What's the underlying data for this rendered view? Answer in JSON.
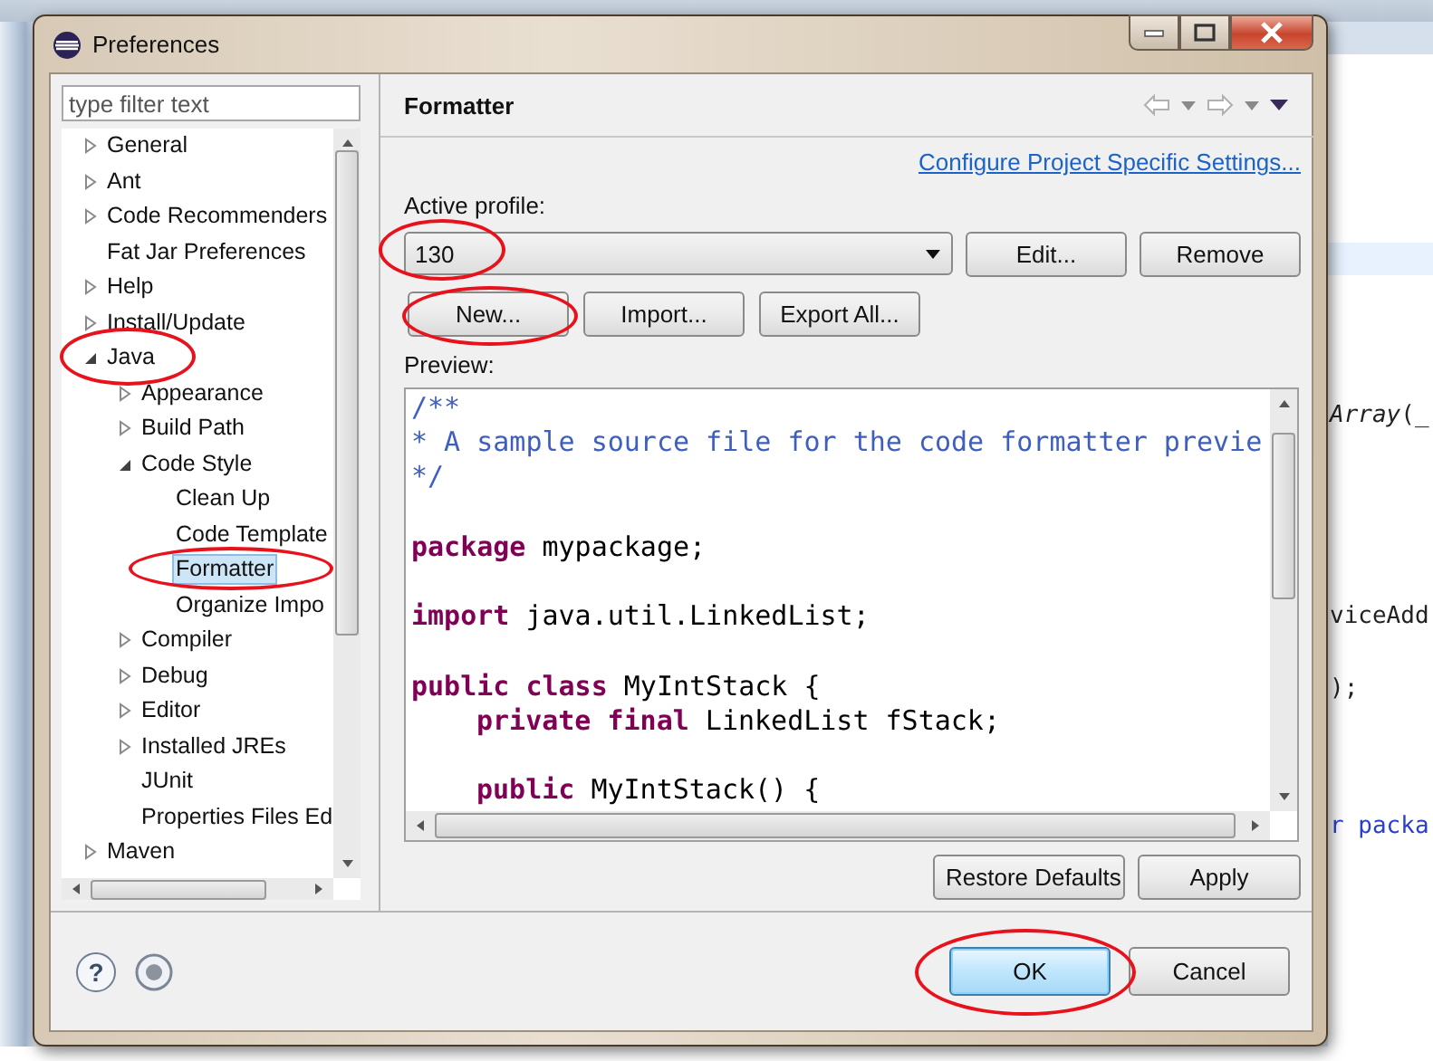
{
  "background_editor": {
    "fragments": [
      {
        "text": "*Array*(_",
        "kind": "code"
      },
      {
        "text": "viceAdd",
        "kind": "code"
      },
      {
        "text": ");",
        "kind": "code"
      },
      {
        "text": "r packa",
        "kind": "keyword"
      }
    ]
  },
  "window": {
    "title": "Preferences"
  },
  "filter": {
    "placeholder": "type filter text"
  },
  "tree": [
    {
      "label": "General",
      "kind": "folder",
      "expanded": false,
      "selected": false
    },
    {
      "label": "Ant",
      "kind": "folder",
      "expanded": false,
      "selected": false
    },
    {
      "label": "Code Recommenders",
      "kind": "folder",
      "expanded": false,
      "selected": false
    },
    {
      "label": "Fat Jar Preferences",
      "kind": "leaf",
      "selected": false
    },
    {
      "label": "Help",
      "kind": "folder",
      "expanded": false,
      "selected": false
    },
    {
      "label": "Install/Update",
      "kind": "folder",
      "expanded": false,
      "selected": false
    },
    {
      "label": "Java",
      "kind": "folder",
      "expanded": true,
      "selected": false,
      "circled": true,
      "children": [
        {
          "label": "Appearance",
          "kind": "folder",
          "expanded": false,
          "selected": false
        },
        {
          "label": "Build Path",
          "kind": "folder",
          "expanded": false,
          "selected": false
        },
        {
          "label": "Code Style",
          "kind": "folder",
          "expanded": true,
          "selected": false,
          "children": [
            {
              "label": "Clean Up",
              "kind": "leaf",
              "selected": false
            },
            {
              "label": "Code Template",
              "kind": "leaf",
              "selected": false
            },
            {
              "label": "Formatter",
              "kind": "leaf",
              "selected": true,
              "circled": true
            },
            {
              "label": "Organize Impo",
              "kind": "leaf",
              "selected": false
            }
          ]
        },
        {
          "label": "Compiler",
          "kind": "folder",
          "expanded": false,
          "selected": false
        },
        {
          "label": "Debug",
          "kind": "folder",
          "expanded": false,
          "selected": false
        },
        {
          "label": "Editor",
          "kind": "folder",
          "expanded": false,
          "selected": false
        },
        {
          "label": "Installed JREs",
          "kind": "folder",
          "expanded": false,
          "selected": false
        },
        {
          "label": "JUnit",
          "kind": "leaf",
          "selected": false
        },
        {
          "label": "Properties Files Ed",
          "kind": "leaf",
          "selected": false
        }
      ]
    },
    {
      "label": "Maven",
      "kind": "folder",
      "expanded": false,
      "selected": false
    }
  ],
  "page": {
    "title": "Formatter",
    "link": "Configure Project Specific Settings...",
    "profile_label": "Active profile:",
    "profile": {
      "value": "130",
      "circled": true
    },
    "profile_buttons": [
      {
        "label": "Edit...",
        "circled": false
      },
      {
        "label": "Remove",
        "circled": false
      }
    ],
    "buttons": [
      {
        "label": "New...",
        "circled": true
      },
      {
        "label": "Import...",
        "circled": false
      },
      {
        "label": "Export All...",
        "circled": false
      }
    ],
    "preview_label": "Preview:",
    "preview_lines": [
      {
        "kind": "code",
        "tokens": [
          {
            "kind": "comment",
            "text": "/**"
          }
        ]
      },
      {
        "kind": "code",
        "tokens": [
          {
            "kind": "comment",
            "text": "* A sample source file for the code formatter previe"
          }
        ]
      },
      {
        "kind": "code",
        "tokens": [
          {
            "kind": "comment",
            "text": "*/"
          }
        ]
      },
      {
        "kind": "blank"
      },
      {
        "kind": "code",
        "tokens": [
          {
            "kind": "keyword",
            "text": "package"
          },
          {
            "kind": "text",
            "text": " mypackage;"
          }
        ]
      },
      {
        "kind": "blank"
      },
      {
        "kind": "code",
        "tokens": [
          {
            "kind": "keyword",
            "text": "import"
          },
          {
            "kind": "text",
            "text": " java.util.LinkedList;"
          }
        ]
      },
      {
        "kind": "blank"
      },
      {
        "kind": "code",
        "tokens": [
          {
            "kind": "keyword",
            "text": "public class"
          },
          {
            "kind": "text",
            "text": " MyIntStack {"
          }
        ]
      },
      {
        "kind": "nested_code",
        "tokens": [
          {
            "kind": "keyword",
            "text": "private final"
          },
          {
            "kind": "text",
            "text": " LinkedList fStack;"
          }
        ]
      },
      {
        "kind": "blank"
      },
      {
        "kind": "nested_code",
        "tokens": [
          {
            "kind": "keyword",
            "text": "public"
          },
          {
            "kind": "text",
            "text": " MyIntStack() {"
          }
        ]
      }
    ],
    "bottom_buttons": [
      "Restore Defaults",
      "Apply"
    ]
  },
  "footer": {
    "help_glyph": "?",
    "buttons": [
      {
        "label": "OK",
        "default": true,
        "circled": true
      },
      {
        "label": "Cancel",
        "default": false,
        "circled": false
      }
    ]
  }
}
